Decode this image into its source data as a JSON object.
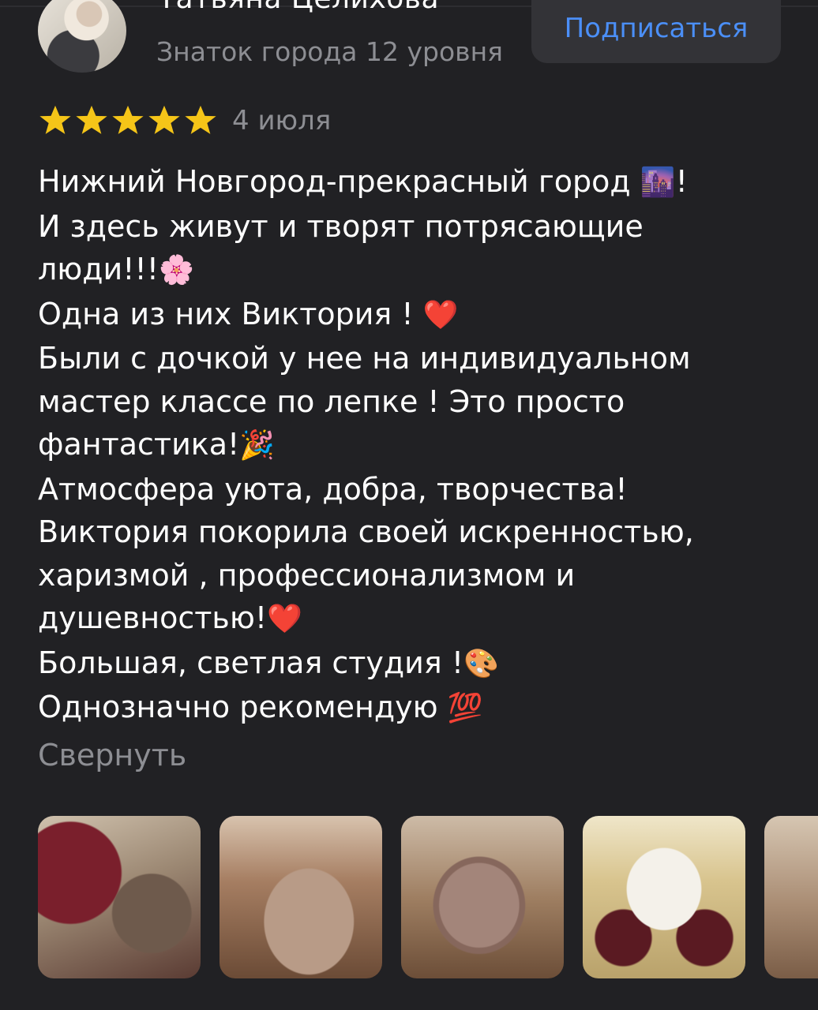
{
  "user": {
    "name": "Татьяна Целихова",
    "level": "Знаток города 12 уровня",
    "subscribe_label": "Подписаться"
  },
  "rating": {
    "stars": 5,
    "max": 5,
    "star_color": "#f5c518"
  },
  "date": "4 июля",
  "review_lines": [
    {
      "text": "Нижний Новгород-прекрасный город ",
      "emoji": "🌆",
      "after": "!"
    },
    {
      "text": "И здесь живут и творят потрясающие",
      "emoji": "",
      "after": ""
    },
    {
      "text": "люди!!!",
      "emoji": "🌸",
      "after": ""
    },
    {
      "text": "Одна из них Виктория ! ",
      "emoji": "❤️",
      "after": ""
    },
    {
      "text": "Были с дочкой у нее на индивидуальном",
      "emoji": "",
      "after": ""
    },
    {
      "text": "мастер классе по лепке ! Это просто",
      "emoji": "",
      "after": ""
    },
    {
      "text": "фантастика!",
      "emoji": "🎉",
      "after": ""
    },
    {
      "text": "Атмосфера уюта, добра, творчества!",
      "emoji": "",
      "after": ""
    },
    {
      "text": "Виктория покорила своей искренностью,",
      "emoji": "",
      "after": ""
    },
    {
      "text": "харизмой , профессионализмом и",
      "emoji": "",
      "after": ""
    },
    {
      "text": "душевностью!",
      "emoji": "❤️",
      "after": ""
    },
    {
      "text": "Большая, светлая студия !",
      "emoji": "🎨",
      "after": ""
    },
    {
      "text": "Однозначно рекомендую ",
      "emoji": "💯",
      "after": ""
    }
  ],
  "collapse_label": "Свернуть",
  "photos": [
    {
      "icon": "photo-clay-hands"
    },
    {
      "icon": "photo-clay-tool"
    },
    {
      "icon": "photo-clay-plate"
    },
    {
      "icon": "photo-studio-group"
    },
    {
      "icon": "photo-clay-plate-2"
    }
  ],
  "colors": {
    "background": "#212124",
    "secondary_text": "#8d8e93",
    "accent": "#4b8ff7",
    "button_bg": "#333337"
  }
}
